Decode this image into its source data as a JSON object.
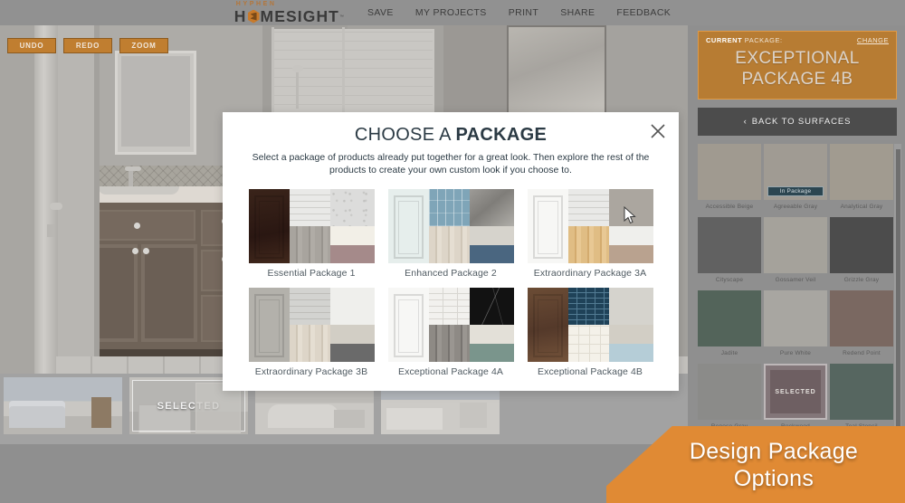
{
  "header": {
    "brand_top": "HYPHEN",
    "brand_part1": "H",
    "brand_part2": "MESIGHT",
    "brand_tm": "™",
    "nav": [
      {
        "label": "SAVE",
        "name": "save"
      },
      {
        "label": "MY PROJECTS",
        "name": "my-projects"
      },
      {
        "label": "PRINT",
        "name": "print"
      },
      {
        "label": "SHARE",
        "name": "share"
      },
      {
        "label": "FEEDBACK",
        "name": "feedback"
      }
    ]
  },
  "toolbar": {
    "undo_label": "UNDO",
    "redo_label": "REDO",
    "zoom_label": "ZOOM"
  },
  "thumbnails": [
    {
      "label": "",
      "selected_label": "",
      "room": "bedroom"
    },
    {
      "label": "",
      "selected_label": "SELECTED",
      "room": "bath"
    },
    {
      "label": "",
      "selected_label": "",
      "room": "kitchen1"
    },
    {
      "label": "",
      "selected_label": "",
      "room": "kitchen2"
    }
  ],
  "right_panel": {
    "current_label_bold": "CURRENT",
    "current_label_rest": " PACKAGE:",
    "change_label": "CHANGE",
    "package_name_line1": "EXCEPTIONAL",
    "package_name_line2": "PACKAGE 4B",
    "back_label": "BACK TO SURFACES",
    "back_chevron": "‹",
    "accent_color": "#b77c33",
    "accent_border": "#e09a45",
    "swatches": [
      {
        "name": "Accessible Beige",
        "color": "#a09a90",
        "badge": null,
        "state": null
      },
      {
        "name": "Agreeable Gray",
        "color": "#a09b93",
        "badge": "In Package",
        "state": null
      },
      {
        "name": "Analytical Gray",
        "color": "#a19b90",
        "badge": null,
        "state": null
      },
      {
        "name": "Cityscape",
        "color": "#616161",
        "badge": null,
        "state": null
      },
      {
        "name": "Gossamer Veil",
        "color": "#a5a29b",
        "badge": null,
        "state": null
      },
      {
        "name": "Grizzle Gray",
        "color": "#4c4c4c",
        "badge": null,
        "state": null
      },
      {
        "name": "Jadite",
        "color": "#53645a",
        "badge": null,
        "state": null
      },
      {
        "name": "Pure White",
        "color": "#a8a6a1",
        "badge": null,
        "state": null
      },
      {
        "name": "Redend Point",
        "color": "#7a6861",
        "badge": null,
        "state": null
      },
      {
        "name": "Repose Gray",
        "color": "#8b8b89",
        "badge": null,
        "state": null
      },
      {
        "name": "Rockwood",
        "color": "#6e5f62",
        "badge": null,
        "state": "SELECTED"
      },
      {
        "name": "Teal Stencil",
        "color": "#566660",
        "badge": null,
        "state": null
      }
    ]
  },
  "modal": {
    "title_light": "CHOOSE A ",
    "title_bold": "PACKAGE",
    "subtitle": "Select a package of products already put together for a great look. Then explore the rest of the products to create your own custom look if you choose to.",
    "close_icon": "close-icon",
    "packages": [
      {
        "label": "Essential Package 1",
        "tiles": [
          "tex-subway-white",
          "tex-speck",
          "tex-wood-grey",
          "tex-cream",
          "tex-mauve"
        ],
        "door": "tex-darkwood"
      },
      {
        "label": "Enhanced Package 2",
        "tiles": [
          "tex-blue-picket",
          "tex-concrete",
          "tex-wood-light",
          "tex-greige",
          "tex-navyblock"
        ],
        "door": "tex-mintdoor"
      },
      {
        "label": "Extraordinary Package 3A",
        "tiles": [
          "tex-subway-white",
          "tex-warmgrey",
          "tex-wood-oak",
          "tex-softwhite",
          "tex-tan"
        ],
        "door": "tex-whitedoor"
      },
      {
        "label": "Extraordinary Package 3B",
        "tiles": [
          "tex-subway-grey",
          "tex-softwhite",
          "tex-wood-light",
          "tex-taupe",
          "tex-charcoal"
        ],
        "door": "tex-greydoor"
      },
      {
        "label": "Exceptional Package 4A",
        "tiles": [
          "tex-brickwhite",
          "tex-blackmarble",
          "tex-wood-dkgrey",
          "tex-linen",
          "tex-sage"
        ],
        "door": "tex-whitedoor"
      },
      {
        "label": "Exceptional Package 4B",
        "tiles": [
          "tex-navybrick",
          "tex-palegrey",
          "tex-grid-cream",
          "tex-taupe",
          "tex-lightblue"
        ],
        "door": "tex-browndoor"
      }
    ]
  },
  "banner": {
    "line1": "Design Package",
    "line2": "Options",
    "color": "#e08a34"
  }
}
